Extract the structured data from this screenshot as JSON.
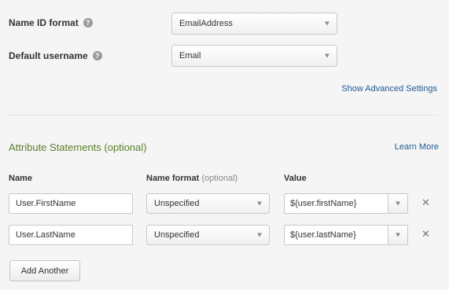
{
  "settings": {
    "name_id_format": {
      "label": "Name ID format",
      "value": "EmailAddress"
    },
    "default_username": {
      "label": "Default username",
      "value": "Email"
    },
    "advanced_link": "Show Advanced Settings"
  },
  "attributes": {
    "title": "Attribute Statements (optional)",
    "learn_more": "Learn More",
    "columns": {
      "name": "Name",
      "name_format": "Name format",
      "name_format_optional": "(optional)",
      "value": "Value"
    },
    "rows": [
      {
        "name": "User.FirstName",
        "format": "Unspecified",
        "value": "${user.firstName}"
      },
      {
        "name": "User.LastName",
        "format": "Unspecified",
        "value": "${user.lastName}"
      }
    ],
    "add_button": "Add Another"
  },
  "icons": {
    "help": "help-circle-icon",
    "remove": "close-icon",
    "dropdown": "chevron-down-icon"
  }
}
